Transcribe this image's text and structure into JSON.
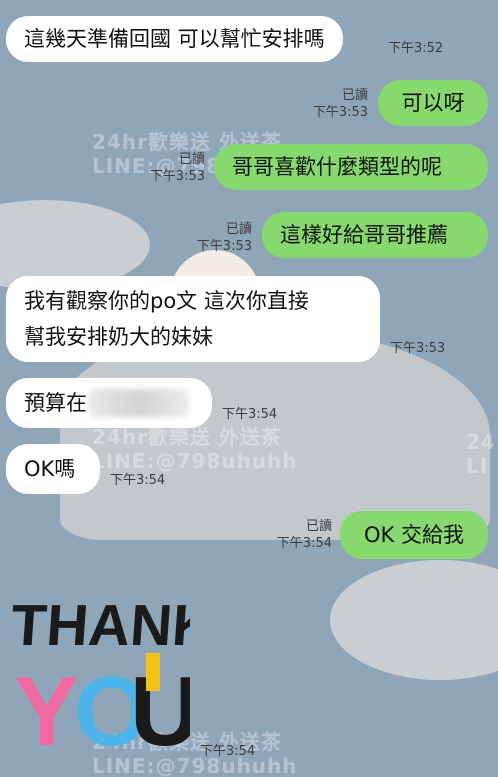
{
  "watermark": {
    "line1": "24hr歡樂送 外送茶",
    "line2": "LINE:@798uhuhh",
    "short_right": "24",
    "short_line": "LI"
  },
  "messages": [
    {
      "dir": "in",
      "text": "這幾天準備回國 可以幫忙安排嗎",
      "time": "下午3:52"
    },
    {
      "dir": "out",
      "text": "可以呀",
      "read": "已讀",
      "time": "下午3:53"
    },
    {
      "dir": "out",
      "text": "哥哥喜歡什麼類型的呢",
      "read": "已讀",
      "time": "下午3:53"
    },
    {
      "dir": "out",
      "text": "這樣好給哥哥推薦",
      "read": "已讀",
      "time": "下午3:53"
    },
    {
      "dir": "in",
      "line1": "我有觀察你的po文 這次你直接",
      "line2": "幫我安排奶大的妹妹",
      "time": "下午3:53"
    },
    {
      "dir": "in",
      "text": "預算在",
      "time": "下午3:54"
    },
    {
      "dir": "in",
      "text": "OK嗎",
      "time": "下午3:54"
    },
    {
      "dir": "out",
      "text": "OK 交給我",
      "read": "已讀",
      "time": "下午3:54"
    }
  ],
  "sticker": {
    "word1": "THANK",
    "y": "Y",
    "o": "O",
    "u": "U",
    "time": "下午3:54",
    "colors": {
      "dark": "#1a1a1a",
      "pink": "#f06ba1",
      "blue": "#4db3e8",
      "yellow": "#f2c21a"
    }
  },
  "colors": {
    "background": "#8fa5b8",
    "incoming": "#ffffff",
    "outgoing": "#86d86f"
  }
}
